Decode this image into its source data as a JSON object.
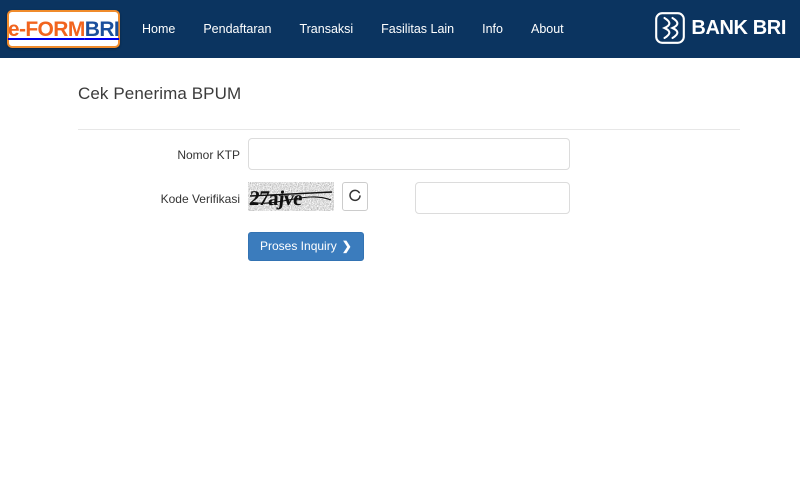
{
  "header": {
    "brand": {
      "icon": "eform-bri-logo",
      "text_primary": "e-FORM",
      "text_secondary": "BRI"
    },
    "nav_items": [
      {
        "label": "Home",
        "name": "nav-home"
      },
      {
        "label": "Pendaftaran",
        "name": "nav-pendaftaran"
      },
      {
        "label": "Transaksi",
        "name": "nav-transaksi"
      },
      {
        "label": "Fasilitas Lain",
        "name": "nav-fasilitas-lain"
      },
      {
        "label": "Info",
        "name": "nav-info"
      },
      {
        "label": "About",
        "name": "nav-about"
      }
    ],
    "bank_logo": {
      "icon": "bank-bri-logo-icon",
      "label": "BANK BRI"
    }
  },
  "page": {
    "title": "Cek Penerima BPUM"
  },
  "form": {
    "ktp": {
      "label": "Nomor KTP",
      "value": "",
      "placeholder": ""
    },
    "captcha": {
      "label": "Kode Verifikasi",
      "image_text": "27ajve",
      "refresh_icon": "refresh-icon",
      "refresh_title": "Refresh",
      "answer_value": "",
      "answer_placeholder": ""
    },
    "submit": {
      "label": "Proses Inquiry",
      "chevron": "❯"
    }
  },
  "colors": {
    "navbar": "#0b3460",
    "brand_orange": "#f1641e",
    "brand_blue": "#1b4f9c",
    "button_blue": "#3b7cbd",
    "page_bg": "#ffffff",
    "rule": "#e7e7e7"
  }
}
